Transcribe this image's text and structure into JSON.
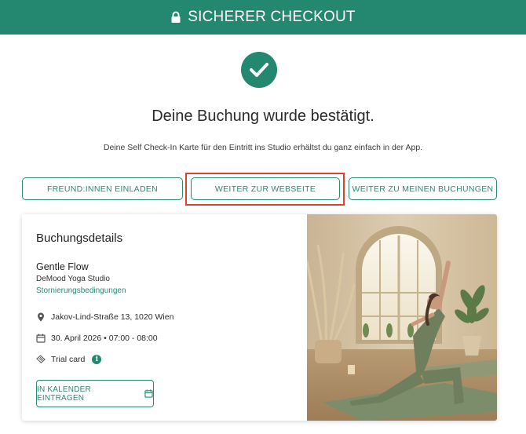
{
  "header": {
    "title": "SICHERER CHECKOUT",
    "icon": "lock-icon"
  },
  "confirmation": {
    "icon": "checkmark-icon",
    "headline": "Deine Buchung wurde bestätigt.",
    "subline": "Deine Self Check-In Karte für den Eintritt ins Studio erhältst du ganz einfach in der App."
  },
  "actions": {
    "invite_label": "FREUND:INNEN EINLADEN",
    "website_label": "WEITER ZUR WEBSEITE",
    "bookings_label": "WEITER ZU MEINEN BUCHUNGEN"
  },
  "booking": {
    "title": "Buchungsdetails",
    "class_name": "Gentle Flow",
    "studio": "DeMood Yoga Studio",
    "cancellation_link": "Stornierungsbedingungen",
    "address": "Jakov-Lind-Straße 13, 1020 Wien",
    "datetime": "30. April 2026 • 07:00 - 08:00",
    "ticket": "Trial card",
    "calendar_label": "IN KALENDER EINTRAGEN"
  },
  "colors": {
    "brand": "#24876f",
    "highlight": "#e1412c"
  }
}
